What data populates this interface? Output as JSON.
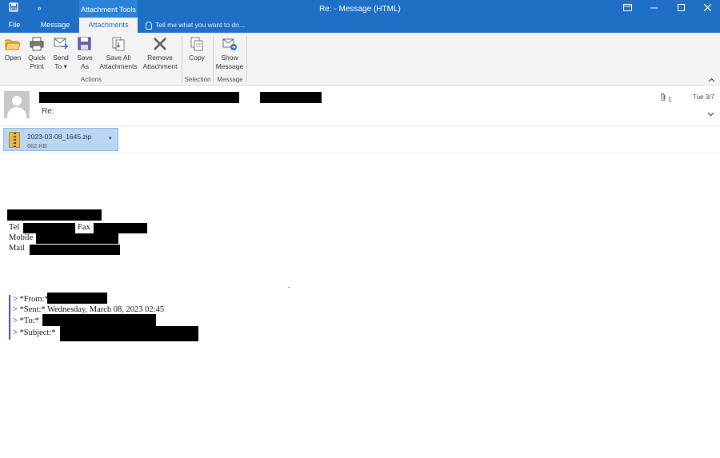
{
  "titlebar": {
    "contextual_tab": "Attachment Tools",
    "title": "Re: - Message (HTML)"
  },
  "tabs": [
    {
      "label": "File"
    },
    {
      "label": "Message"
    },
    {
      "label": "Attachments"
    }
  ],
  "tell_me": "Tell me what you want to do...",
  "ribbon": {
    "open": "Open",
    "quick_print": [
      "Quick",
      "Print"
    ],
    "send_to": [
      "Send",
      "To ▾"
    ],
    "save_as": [
      "Save",
      "As"
    ],
    "save_all": [
      "Save All",
      "Attachments"
    ],
    "remove": [
      "Remove",
      "Attachment"
    ],
    "copy": "Copy",
    "show_message": [
      "Show",
      "Message"
    ],
    "groups": {
      "actions": "Actions",
      "selection": "Selection",
      "message": "Message"
    }
  },
  "message": {
    "subject": "Re:",
    "attachment_count": "1",
    "date": "Tue 3/7"
  },
  "attachment": {
    "name": "2023-03-08_1645.zip",
    "size": "662 KB"
  },
  "body": {
    "sig_tel": "Tel",
    "sig_fax": "Fax",
    "sig_mobile": "Mobile",
    "sig_mail": "Mail",
    "dot": ".",
    "quote_from": "> *From:*",
    "quote_sent": "> *Sent:* Wednesday, March 08, 2023 02:45",
    "quote_to": "> *To:*",
    "quote_subject": "> *Subject:*"
  },
  "colors": {
    "accent": "#1e6fc5",
    "attachment_bg": "#b9d7f2"
  }
}
